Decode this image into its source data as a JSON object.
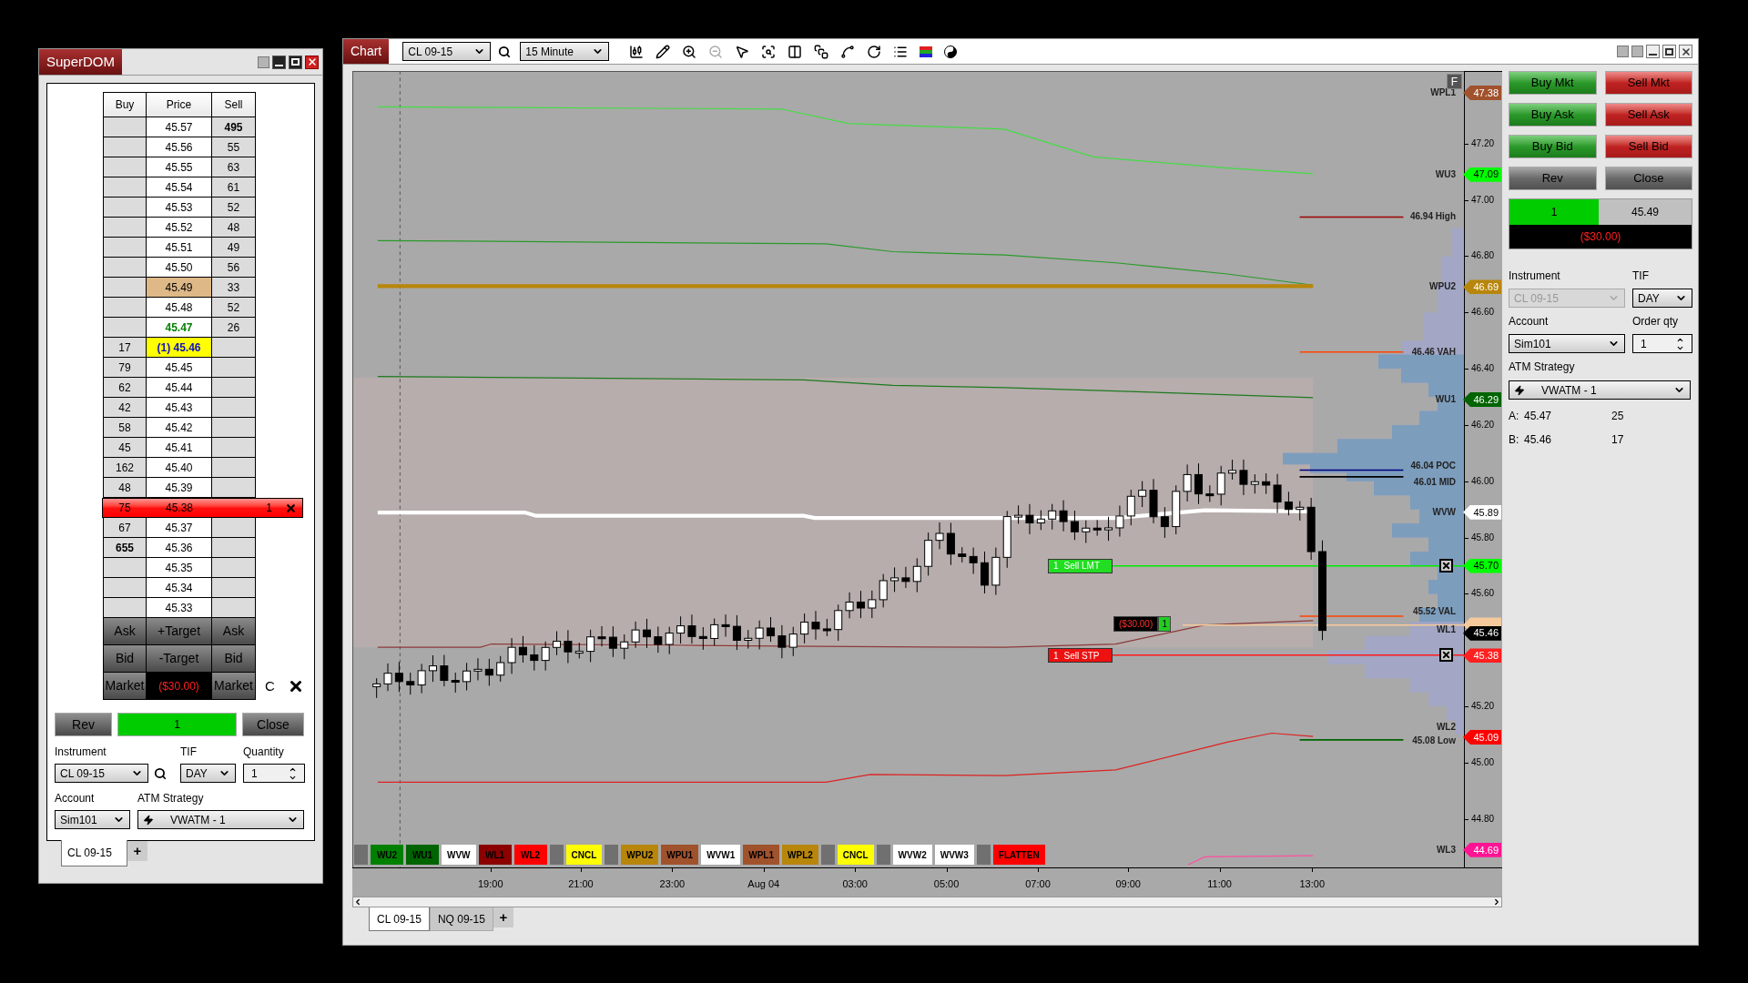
{
  "superdom": {
    "title": "SuperDOM",
    "columns": [
      "Buy",
      "Price",
      "Sell"
    ],
    "rows": [
      {
        "price": "45.57",
        "sell": "495",
        "kind": "plain",
        "bold": true
      },
      {
        "price": "45.56",
        "sell": "55",
        "kind": "plain",
        "bold": false
      },
      {
        "price": "45.55",
        "sell": "63",
        "kind": "plain",
        "bold": false
      },
      {
        "price": "45.54",
        "sell": "61",
        "kind": "plain",
        "bold": false
      },
      {
        "price": "45.53",
        "sell": "52",
        "kind": "plain",
        "bold": false
      },
      {
        "price": "45.52",
        "sell": "48",
        "kind": "plain",
        "bold": false
      },
      {
        "price": "45.51",
        "sell": "49",
        "kind": "plain",
        "bold": false
      },
      {
        "price": "45.50",
        "sell": "56",
        "kind": "plain",
        "bold": false
      },
      {
        "price": "45.49",
        "sell": "33",
        "kind": "last",
        "bold": false
      },
      {
        "price": "45.48",
        "sell": "52",
        "kind": "plain",
        "bold": false
      },
      {
        "price": "45.47",
        "sell": "26",
        "kind": "ask",
        "bold": false
      },
      {
        "buy": "17",
        "price": "(1) 45.46",
        "kind": "bid",
        "bold": false
      },
      {
        "buy": "79",
        "price": "45.45",
        "kind": "plain",
        "bold": false
      },
      {
        "buy": "62",
        "price": "45.44",
        "kind": "plain",
        "bold": false
      },
      {
        "buy": "42",
        "price": "45.43",
        "kind": "plain",
        "bold": false
      },
      {
        "buy": "58",
        "price": "45.42",
        "kind": "plain",
        "bold": false
      },
      {
        "buy": "45",
        "price": "45.41",
        "kind": "plain",
        "bold": false
      },
      {
        "buy": "162",
        "price": "45.40",
        "kind": "plain",
        "bold": false
      },
      {
        "buy": "48",
        "price": "45.39",
        "kind": "plain",
        "bold": false
      },
      {
        "buy": "75",
        "price": "45.38",
        "kind": "order",
        "order_qty": "1",
        "bold": false
      },
      {
        "buy": "67",
        "price": "45.37",
        "kind": "plain",
        "bold": false
      },
      {
        "buy": "655",
        "price": "45.36",
        "kind": "plain",
        "bold": true
      },
      {
        "price": "45.35",
        "kind": "plain"
      },
      {
        "price": "45.34",
        "kind": "plain"
      },
      {
        "price": "45.33",
        "kind": "plain"
      }
    ],
    "action_rows": [
      [
        {
          "label": "Ask",
          "kind": "button"
        },
        {
          "label": "+Target",
          "kind": "button"
        },
        {
          "label": "Ask",
          "kind": "button"
        }
      ],
      [
        {
          "label": "Bid",
          "kind": "button"
        },
        {
          "label": "-Target",
          "kind": "button"
        },
        {
          "label": "Bid",
          "kind": "button"
        }
      ],
      [
        {
          "label": "Market",
          "kind": "button"
        },
        {
          "label": "($30.00)",
          "kind": "pnl"
        },
        {
          "label": "Market",
          "kind": "button"
        }
      ]
    ],
    "center_button": "C",
    "position": {
      "rev": "Rev",
      "qty": "1",
      "close": "Close"
    },
    "instrument": {
      "label": "Instrument",
      "value": "CL 09-15"
    },
    "tif": {
      "label": "TIF",
      "value": "DAY"
    },
    "quantity": {
      "label": "Quantity",
      "value": "1"
    },
    "account": {
      "label": "Account",
      "value": "Sim101"
    },
    "atm_strategy": {
      "label": "ATM Strategy",
      "value": "VWATM - 1"
    },
    "tabs": [
      {
        "label": "CL 09-15",
        "selected": true
      }
    ],
    "add_tab": "+"
  },
  "chart": {
    "title": "Chart",
    "instrument": "CL 09-15",
    "interval": "15 Minute",
    "corner_button": "F",
    "plot_labels": [
      "WPL1",
      "WU3",
      "46.94 High",
      "WPU2",
      "46.46 VAH",
      "WU1",
      "46.04 POC",
      "46.01 MID",
      "WVW",
      "45.52 VAL",
      "WL1",
      "WL2",
      "45.08 Low",
      "WL3"
    ],
    "price_markers": [
      {
        "text": "47.38",
        "color": "#a0522d"
      },
      {
        "text": "47.09",
        "color": "#00ff00"
      },
      {
        "text": "46.69",
        "color": "#b8860b"
      },
      {
        "text": "46.29",
        "color": "#006400"
      },
      {
        "text": "45.89",
        "color": "#ffffff"
      },
      {
        "text": "45.70",
        "color": "#00ff00"
      },
      {
        "color": "#f5c99b"
      },
      {
        "text": "45.46",
        "color": "#000000"
      },
      {
        "text": "45.38",
        "color": "#ff2020"
      },
      {
        "text": "45.09",
        "color": "#ff0000"
      },
      {
        "text": "44.69",
        "color": "#ff1493"
      }
    ],
    "price_ticks": [
      "47.20",
      "47.00",
      "46.80",
      "46.60",
      "46.40",
      "46.20",
      "46.00",
      "45.80",
      "45.60",
      "45.20",
      "45.00",
      "44.80"
    ],
    "time_ticks": [
      "19:00",
      "21:00",
      "23:00",
      "Aug 04",
      "03:00",
      "05:00",
      "07:00",
      "09:00",
      "11:00",
      "13:00"
    ],
    "orders": [
      {
        "qty": "1",
        "label": "Sell LMT",
        "kind": "limit"
      },
      {
        "qty": "1",
        "label": "Sell STP",
        "kind": "stop"
      }
    ],
    "position": {
      "pnl": "($30.00)",
      "qty": "1"
    },
    "strip_buttons": [
      {
        "kind": "spacer"
      },
      {
        "kind": "button",
        "label": "WU2",
        "color": "#008000"
      },
      {
        "kind": "button",
        "label": "WU1",
        "color": "#006400"
      },
      {
        "kind": "button",
        "label": "WVW",
        "color": "#ffffff"
      },
      {
        "kind": "button",
        "label": "WL1",
        "color": "#8b0000"
      },
      {
        "kind": "button",
        "label": "WL2",
        "color": "#ff0000"
      },
      {
        "kind": "spacer"
      },
      {
        "kind": "button",
        "label": "CNCL",
        "color": "#ffff00"
      },
      {
        "kind": "spacer"
      },
      {
        "kind": "button",
        "label": "WPU2",
        "color": "#b8860b"
      },
      {
        "kind": "button",
        "label": "WPU1",
        "color": "#a0522d"
      },
      {
        "kind": "button",
        "label": "WVW1",
        "color": "#ffffff"
      },
      {
        "kind": "button",
        "label": "WPL1",
        "color": "#a0522d"
      },
      {
        "kind": "button",
        "label": "WPL2",
        "color": "#b8860b"
      },
      {
        "kind": "spacer"
      },
      {
        "kind": "button",
        "label": "CNCL",
        "color": "#ffff00"
      },
      {
        "kind": "spacer"
      },
      {
        "kind": "button",
        "label": "WVW2",
        "color": "#ffffff"
      },
      {
        "kind": "button",
        "label": "WVW3",
        "color": "#ffffff"
      },
      {
        "kind": "spacer"
      },
      {
        "kind": "button",
        "label": "FLATTEN",
        "color": "#ff0000"
      }
    ],
    "tabs": [
      {
        "label": "CL 09-15",
        "selected": true
      },
      {
        "label": "NQ 09-15",
        "selected": false
      }
    ],
    "add_tab": "+"
  },
  "order_panel": {
    "buttons": [
      {
        "label": "Buy Mkt",
        "kind": "buy"
      },
      {
        "label": "Sell Mkt",
        "kind": "sell"
      },
      {
        "label": "Buy Ask",
        "kind": "buy"
      },
      {
        "label": "Sell Ask",
        "kind": "sell"
      },
      {
        "label": "Buy Bid",
        "kind": "buy"
      },
      {
        "label": "Sell Bid",
        "kind": "sell"
      },
      {
        "label": "Rev",
        "kind": "neutral"
      },
      {
        "label": "Close",
        "kind": "neutral"
      }
    ],
    "position": {
      "qty": "1",
      "price": "45.49",
      "pnl": "($30.00)"
    },
    "instrument": {
      "label": "Instrument",
      "value": "CL 09-15",
      "disabled": true
    },
    "tif": {
      "label": "TIF",
      "value": "DAY"
    },
    "account": {
      "label": "Account",
      "value": "Sim101"
    },
    "order_qty": {
      "label": "Order qty",
      "value": "1"
    },
    "atm_strategy": {
      "label": "ATM Strategy",
      "value": "VWATM - 1"
    },
    "quotes": [
      {
        "side": "A:",
        "price": "45.47",
        "size": "25"
      },
      {
        "side": "B:",
        "price": "45.46",
        "size": "17"
      }
    ]
  }
}
